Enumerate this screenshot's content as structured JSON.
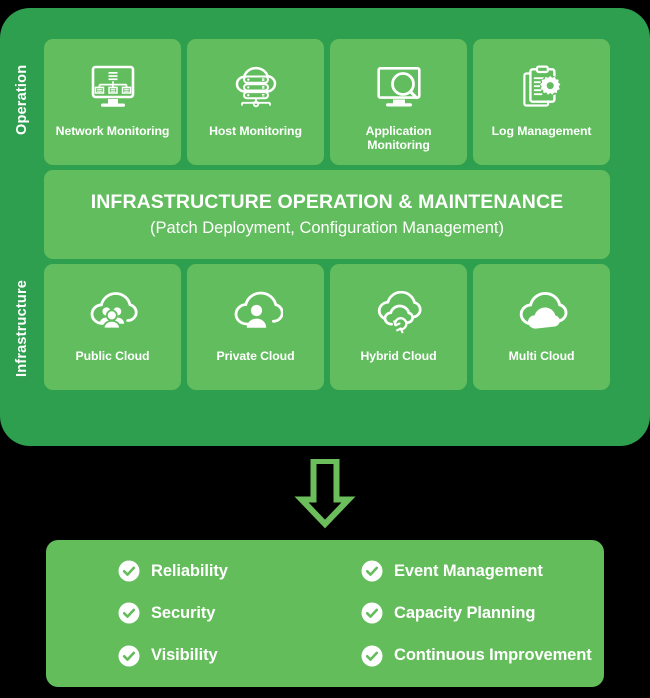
{
  "colors": {
    "outer_panel_green": "#2E9E4F",
    "tile_green": "#62BD5E",
    "benefits_green": "#64BD5B",
    "arrow_green": "#6CBE5C",
    "text_white": "#FFFFFF",
    "page_background": "#000000"
  },
  "stack": {
    "side_labels": {
      "operation": "Operation",
      "infrastructure": "Infrastructure"
    },
    "operation_tiles": [
      {
        "label": "Network Monitoring",
        "icon": "network-monitor-icon"
      },
      {
        "label": "Host Monitoring",
        "icon": "cloud-server-icon"
      },
      {
        "label": "Application Monitoring",
        "icon": "monitor-magnifier-icon"
      },
      {
        "label": "Log Management",
        "icon": "clipboard-gear-icon"
      }
    ],
    "banner": {
      "title": "INFRASTRUCTURE  OPERATION & MAINTENANCE",
      "subtitle": "(Patch Deployment, Configuration Management)"
    },
    "infrastructure_tiles": [
      {
        "label": "Public Cloud",
        "icon": "cloud-people-icon"
      },
      {
        "label": "Private Cloud",
        "icon": "cloud-person-icon"
      },
      {
        "label": "Hybrid Cloud",
        "icon": "cloud-sync-icon"
      },
      {
        "label": "Multi Cloud",
        "icon": "multi-cloud-icon"
      }
    ]
  },
  "connector": {
    "icon": "down-arrow-icon"
  },
  "benefits": {
    "items": [
      {
        "label": "Reliability",
        "icon": "check-circle-icon"
      },
      {
        "label": "Event Management",
        "icon": "check-circle-icon"
      },
      {
        "label": "Security",
        "icon": "check-circle-icon"
      },
      {
        "label": "Capacity Planning",
        "icon": "check-circle-icon"
      },
      {
        "label": "Visibility",
        "icon": "check-circle-icon"
      },
      {
        "label": "Continuous Improvement",
        "icon": "check-circle-icon"
      }
    ]
  }
}
